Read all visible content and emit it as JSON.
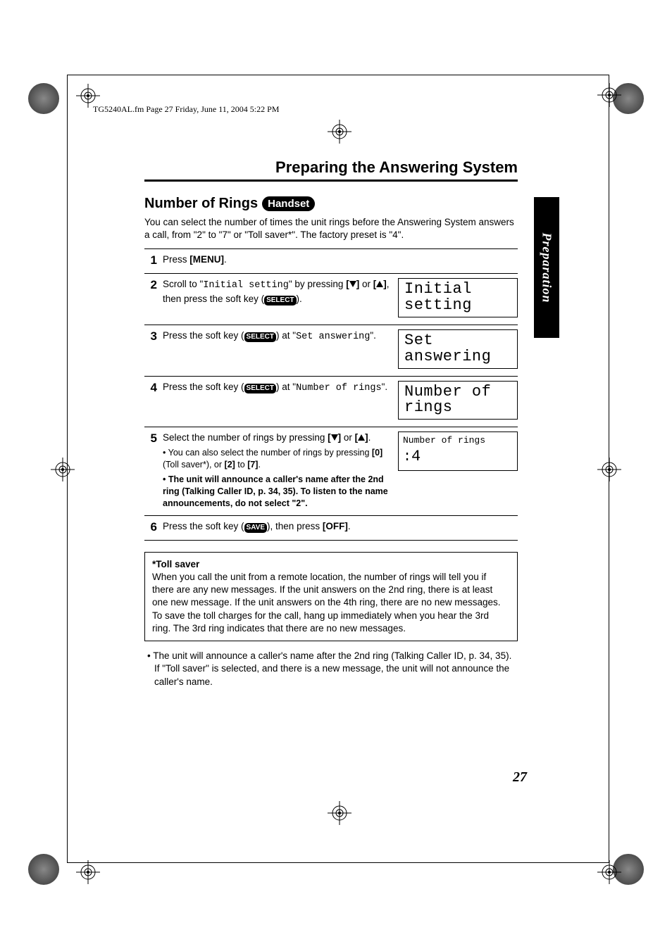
{
  "header_line": "TG5240AL.fm  Page 27  Friday, June 11, 2004  5:22 PM",
  "chapter_title": "Preparing the Answering System",
  "section_title": "Number of Rings",
  "section_badge": "Handset",
  "intro_1": "You can select the number of times the unit rings before the Answering System answers a call, from \"2\" to \"7\" or \"Toll saver*\". The factory preset is \"4\".",
  "select_label": "SELECT",
  "save_label": "SAVE",
  "steps": {
    "s1": {
      "num": "1",
      "a": "Press ",
      "b": "[MENU]",
      "c": "."
    },
    "s2": {
      "num": "2",
      "a": "Scroll to \"",
      "mono": "Initial setting",
      "b": "\" by pressing ",
      "c": "[",
      "d": "]",
      "e": " or ",
      "f": "[",
      "g": "]",
      "h": ", then press the soft key (",
      "i": ")."
    },
    "s3": {
      "num": "3",
      "a": "Press the soft key (",
      "b": ") at \"",
      "mono": "Set answering",
      "c": "\"."
    },
    "s4": {
      "num": "4",
      "a": "Press the soft key (",
      "b": ") at \"",
      "mono": "Number of rings",
      "c": "\"."
    },
    "s5": {
      "num": "5",
      "a": "Select the number of rings by pressing ",
      "b": "[",
      "c": "]",
      "d": " or ",
      "e": "[",
      "f": "]",
      "g": ".",
      "sub1_a": "• You can also select the number of rings by pressing ",
      "sub1_b": "[0]",
      "sub1_c": " (Toll saver*), or ",
      "sub1_d": "[2]",
      "sub1_e": " to ",
      "sub1_f": "[7]",
      "sub1_g": ".",
      "sub2": "• The unit will announce a caller's name after the 2nd ring (Talking Caller ID, p. 34, 35). To listen to the name announcements, do not select \"2\"."
    },
    "s6": {
      "num": "6",
      "a": "Press the soft key (",
      "b": "), then press ",
      "c": "[OFF]",
      "d": "."
    }
  },
  "lcd": {
    "l2": "Initial setting",
    "l2_big": "Initial setting",
    "l3_big": "Set answering",
    "l4_big": "Number of rings",
    "l5_a": "Number of rings",
    "l5_b": ":4",
    "l5_b_big": "4"
  },
  "toll_saver_title": "*Toll saver",
  "toll_saver_body": "When you call the unit from a remote location, the number of rings will tell you if there are any new messages. If the unit answers on the 2nd ring, there is at least one new message. If the unit answers on the 4th ring, there are no new messages. To save the toll charges for the call, hang up immediately when you hear the 3rd ring. The 3rd ring indicates that there are no new messages.",
  "foot_note": "• The unit will announce a caller's name after the 2nd ring (Talking Caller ID, p. 34, 35). If \"Toll saver\" is selected, and there is a new message, the unit will not announce the caller's name.",
  "side_tab": "Preparation",
  "page_num": "27"
}
